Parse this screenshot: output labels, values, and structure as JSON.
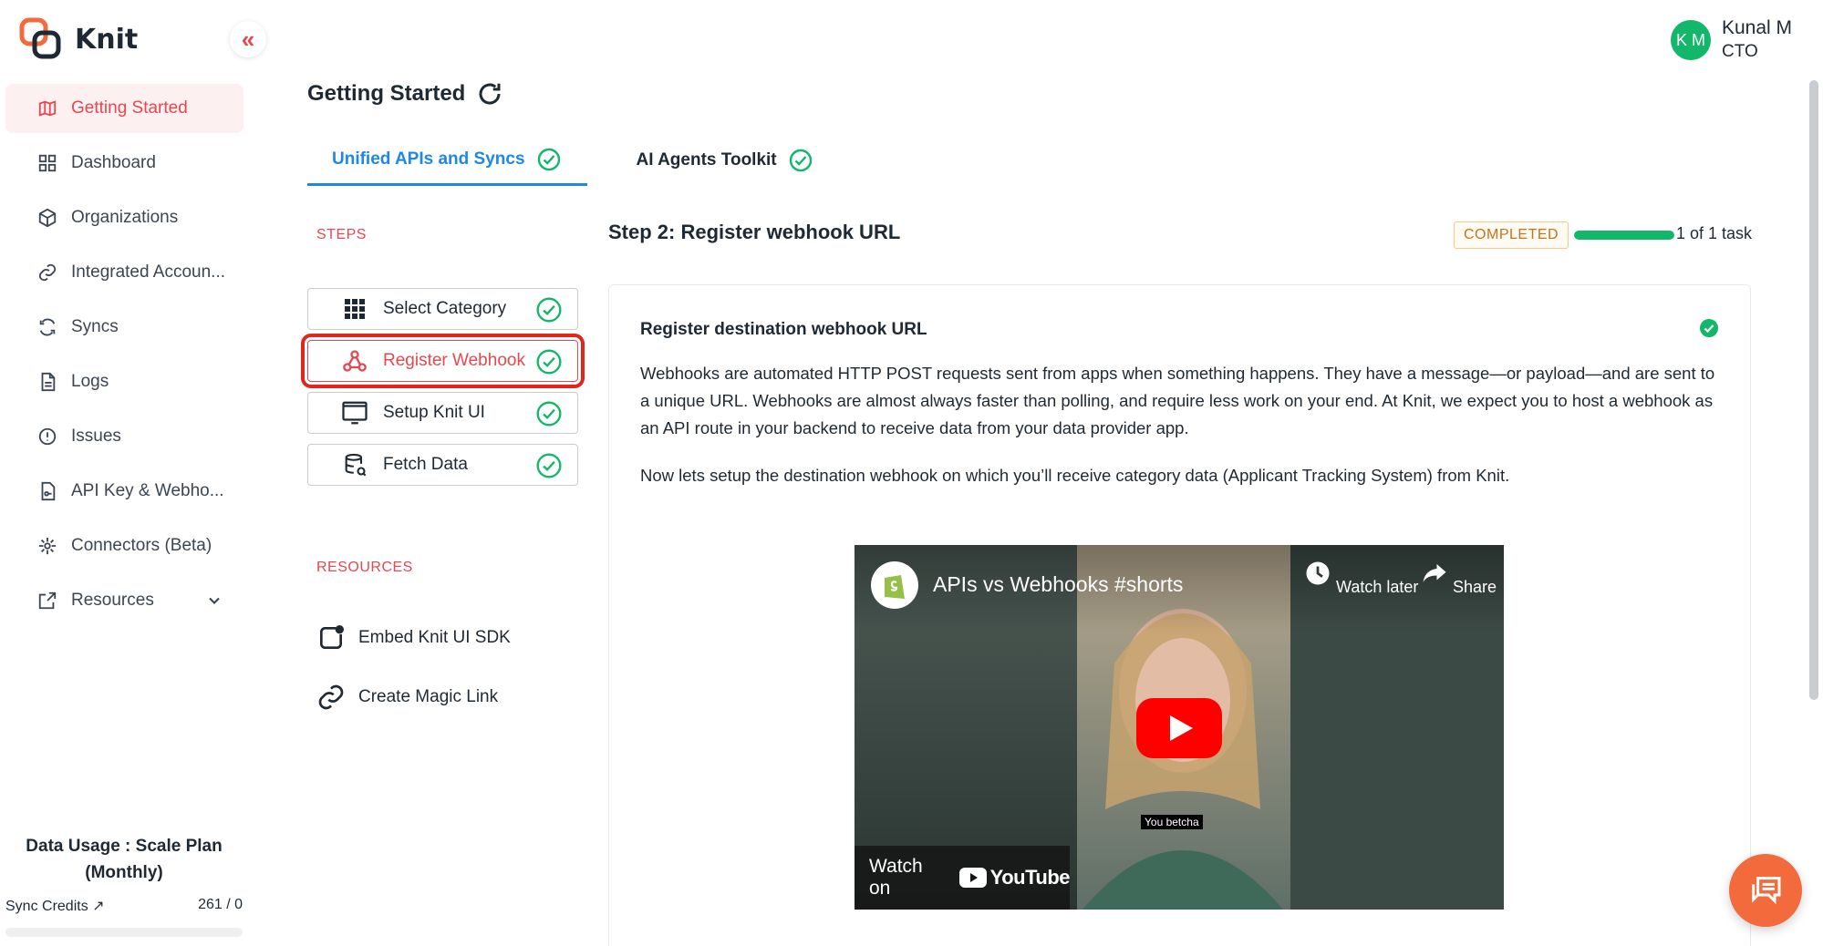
{
  "app": {
    "name": "Knit"
  },
  "sidebar": {
    "items": [
      {
        "label": "Getting Started",
        "icon": "map-icon",
        "active": true
      },
      {
        "label": "Dashboard",
        "icon": "grid-icon"
      },
      {
        "label": "Organizations",
        "icon": "cube-icon"
      },
      {
        "label": "Integrated Accoun...",
        "icon": "link-icon"
      },
      {
        "label": "Syncs",
        "icon": "sync-icon"
      },
      {
        "label": "Logs",
        "icon": "document-icon"
      },
      {
        "label": "Issues",
        "icon": "alert-circle-icon"
      },
      {
        "label": "API Key & Webho...",
        "icon": "key-document-icon"
      },
      {
        "label": "Connectors (Beta)",
        "icon": "connectors-icon"
      },
      {
        "label": "Resources",
        "icon": "external-link-icon"
      }
    ],
    "usage": {
      "title": "Data Usage : Scale Plan (Monthly)",
      "credits_label": "Sync Credits ↗",
      "credits_value": "261 / 0",
      "credits_fraction": 0
    }
  },
  "user": {
    "initials": "K M",
    "name": "Kunal M",
    "role": "CTO"
  },
  "main": {
    "title": "Getting Started",
    "tabs": [
      {
        "label": "Unified APIs and Syncs",
        "active": true,
        "done": true
      },
      {
        "label": "AI Agents Toolkit",
        "active": false,
        "done": true
      }
    ],
    "steps_label": "STEPS",
    "steps": [
      {
        "label": "Select Category",
        "icon": "grid-dots-icon",
        "done": true
      },
      {
        "label": "Register Webhook",
        "icon": "webhook-icon",
        "done": true,
        "active": true
      },
      {
        "label": "Setup Knit UI",
        "icon": "monitor-icon",
        "done": true
      },
      {
        "label": "Fetch Data",
        "icon": "database-icon",
        "done": true
      }
    ],
    "resources_label": "RESOURCES",
    "resources": [
      {
        "label": "Embed Knit UI SDK",
        "icon": "embed-sdk-icon"
      },
      {
        "label": "Create Magic Link",
        "icon": "link-icon"
      }
    ],
    "step_detail": {
      "header": "Step 2: Register webhook URL",
      "status": "COMPLETED",
      "progress_fraction": 1.0,
      "progress_text": "1 of 1 task",
      "card_title": "Register destination webhook URL",
      "paragraph1": "Webhooks are automated HTTP POST requests sent from apps when something happens. They have a message—or payload—and are sent to a unique URL. Webhooks are almost always faster than polling, and require less work on your end. At Knit, we expect you to host a webhook as an API route in your backend to receive data from your data provider app.",
      "paragraph2": "Now lets setup the destination webhook on which you’ll receive category data (Applicant Tracking System) from Knit."
    },
    "video": {
      "title": "APIs vs Webhooks #shorts",
      "watch_later": "Watch later",
      "share": "Share",
      "caption": "You betcha",
      "watch_on": "Watch on",
      "youtube": "YouTube"
    }
  },
  "colors": {
    "accent_red": "#e8474f",
    "tab_blue": "#1e88e5",
    "success_green": "#12b76a",
    "highlight_box": "#e0261d",
    "chat_orange": "#f36a3d"
  }
}
